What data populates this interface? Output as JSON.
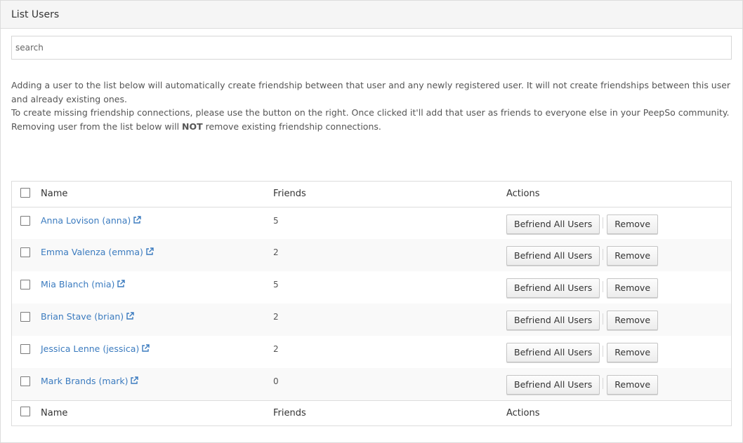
{
  "panel": {
    "title": "List Users"
  },
  "search": {
    "placeholder": "search"
  },
  "info": {
    "line1": "Adding a user to the list below will automatically create friendship between that user and any newly registered user. It will not create friendships between this user and already existing ones.",
    "line2": "To create missing friendship connections, please use the button on the right. Once clicked it'll add that user as friends to everyone else in your PeepSo community.",
    "line3_before": "Removing user from the list below will ",
    "line3_bold": "NOT",
    "line3_after": " remove existing friendship connections."
  },
  "table": {
    "columns": {
      "name": "Name",
      "friends": "Friends",
      "actions": "Actions"
    },
    "rows": [
      {
        "name": "Anna Lovison (anna)",
        "friends": "5"
      },
      {
        "name": "Emma Valenza (emma)",
        "friends": "2"
      },
      {
        "name": "Mia Blanch (mia)",
        "friends": "5"
      },
      {
        "name": "Brian Stave (brian)",
        "friends": "2"
      },
      {
        "name": "Jessica Lenne (jessica)",
        "friends": "2"
      },
      {
        "name": "Mark Brands (mark)",
        "friends": "0"
      }
    ],
    "befriend_label": "Befriend All Users",
    "remove_label": "Remove"
  },
  "colors": {
    "link": "#3b7bbf",
    "header_bg": "#f5f5f5",
    "border": "#dcdcdc"
  },
  "icons": {
    "external_link": "external-link-icon"
  }
}
